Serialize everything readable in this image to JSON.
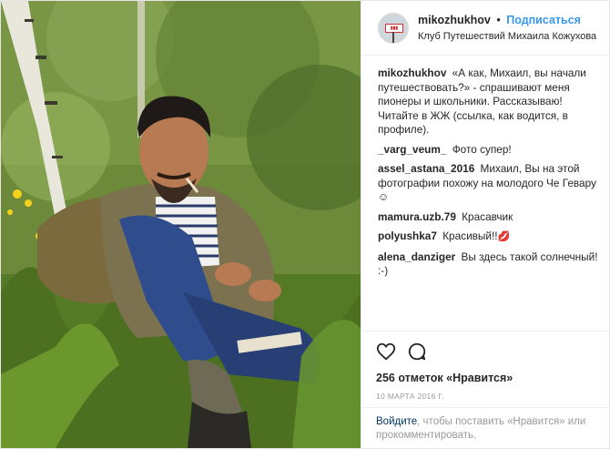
{
  "header": {
    "username": "mikozhukhov",
    "separator": "•",
    "follow_label": "Подписаться",
    "location": "Клуб Путешествий Михаила Кожухова",
    "avatar_icon": "avatar-sign-icon"
  },
  "caption": {
    "user": "mikozhukhov",
    "text": "«А как, Михаил, вы начали путешествовать?» - спрашивают меня пионеры и школьники. Рассказываю! Читайте в ЖЖ (ссылка, как водится, в профиле)."
  },
  "comments": [
    {
      "user": "_varg_veum_",
      "text": "Фото супер!"
    },
    {
      "user": "assel_astana_2016",
      "text": "Михаил, Вы на этой фотографии похожу на молодого Че Гевару ☺"
    },
    {
      "user": "mamura.uzb.79",
      "text": "Красавчик"
    },
    {
      "user": "polyushka7",
      "text": "Красивый!!",
      "emoji": "💋"
    },
    {
      "user": "alena_danziger",
      "text": "Вы здесь такой солнечный! :-)"
    }
  ],
  "actions": {
    "like_icon": "heart-icon",
    "comment_icon": "comment-bubble-icon",
    "likes": "256 отметок «Нравится»",
    "date": "10 марта 2016 г."
  },
  "login": {
    "link_text": "Войдите",
    "rest_text": ", чтобы поставить «Нравится» или прокомментировать."
  },
  "colors": {
    "accent": "#3897f0",
    "text": "#262626",
    "muted": "#999999",
    "link": "#003569",
    "heart": "#ed4956"
  }
}
